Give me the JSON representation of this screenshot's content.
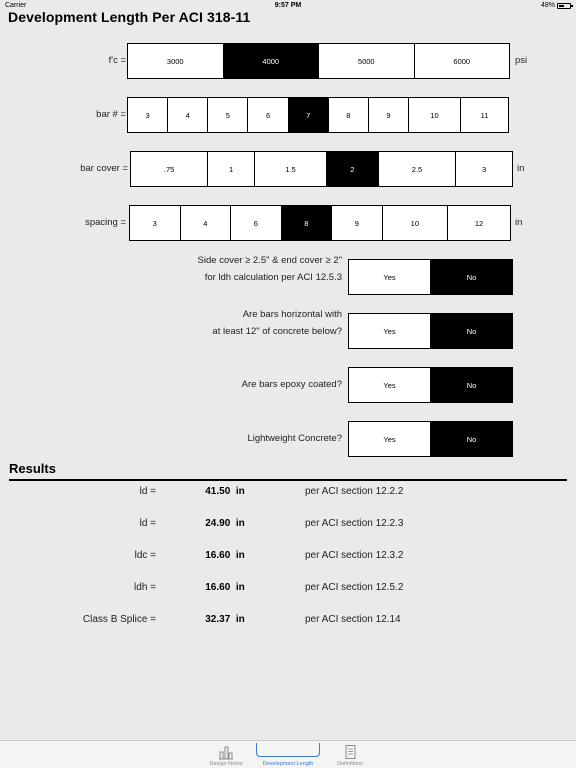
{
  "status": {
    "carrier": "Carrier",
    "time": "9:57 PM",
    "battery": "48%"
  },
  "title": "Development Length Per ACI 318-11",
  "fc": {
    "label": "f'c =",
    "options": [
      "3000",
      "4000",
      "5000",
      "6000"
    ],
    "selected": "4000",
    "unit": "psi"
  },
  "bar": {
    "label": "bar # =",
    "options": [
      "3",
      "4",
      "5",
      "6",
      "7",
      "8",
      "9",
      "10",
      "11"
    ],
    "selected": "7"
  },
  "cover": {
    "label": "bar cover =",
    "options": [
      ".75",
      "1",
      "1.5",
      "2",
      "2.5",
      "3"
    ],
    "selected": "2",
    "unit": "in"
  },
  "spacing": {
    "label": "spacing =",
    "options": [
      "3",
      "4",
      "6",
      "8",
      "9",
      "10",
      "12"
    ],
    "selected": "8",
    "unit": "in"
  },
  "questions": [
    {
      "line1": "Side cover ≥ 2.5\" & end cover ≥ 2\"",
      "line2": "for ldh calculation per ACI 12.5.3",
      "yes": "Yes",
      "no": "No",
      "selected": "No"
    },
    {
      "line1": "Are bars horizontal with",
      "line2": "at least 12\" of concrete below?",
      "yes": "Yes",
      "no": "No",
      "selected": "No"
    },
    {
      "line1": "Are bars epoxy coated?",
      "line2": "",
      "yes": "Yes",
      "no": "No",
      "selected": "No"
    },
    {
      "line1": "Lightweight Concrete?",
      "line2": "",
      "yes": "Yes",
      "no": "No",
      "selected": "No"
    }
  ],
  "results": {
    "title": "Results",
    "rows": [
      {
        "label": "ld =",
        "value": "41.50",
        "unit": "in",
        "ref": "per ACI section 12.2.2"
      },
      {
        "label": "ld =",
        "value": "24.90",
        "unit": "in",
        "ref": "per ACI section 12.2.3"
      },
      {
        "label": "ldc =",
        "value": "16.60",
        "unit": "in",
        "ref": "per ACI section 12.3.2"
      },
      {
        "label": "ldh =",
        "value": "16.60",
        "unit": "in",
        "ref": "per ACI section 12.5.2"
      },
      {
        "label": "Class B Splice =",
        "value": "32.37",
        "unit": "in",
        "ref": "per ACI section 12.14"
      }
    ]
  },
  "tabs": [
    {
      "label": "Design Notes",
      "icon": "design-notes-icon"
    },
    {
      "label": "Development Length",
      "icon": "development-length-icon",
      "active": true
    },
    {
      "label": "Definitions",
      "icon": "definitions-icon"
    }
  ]
}
